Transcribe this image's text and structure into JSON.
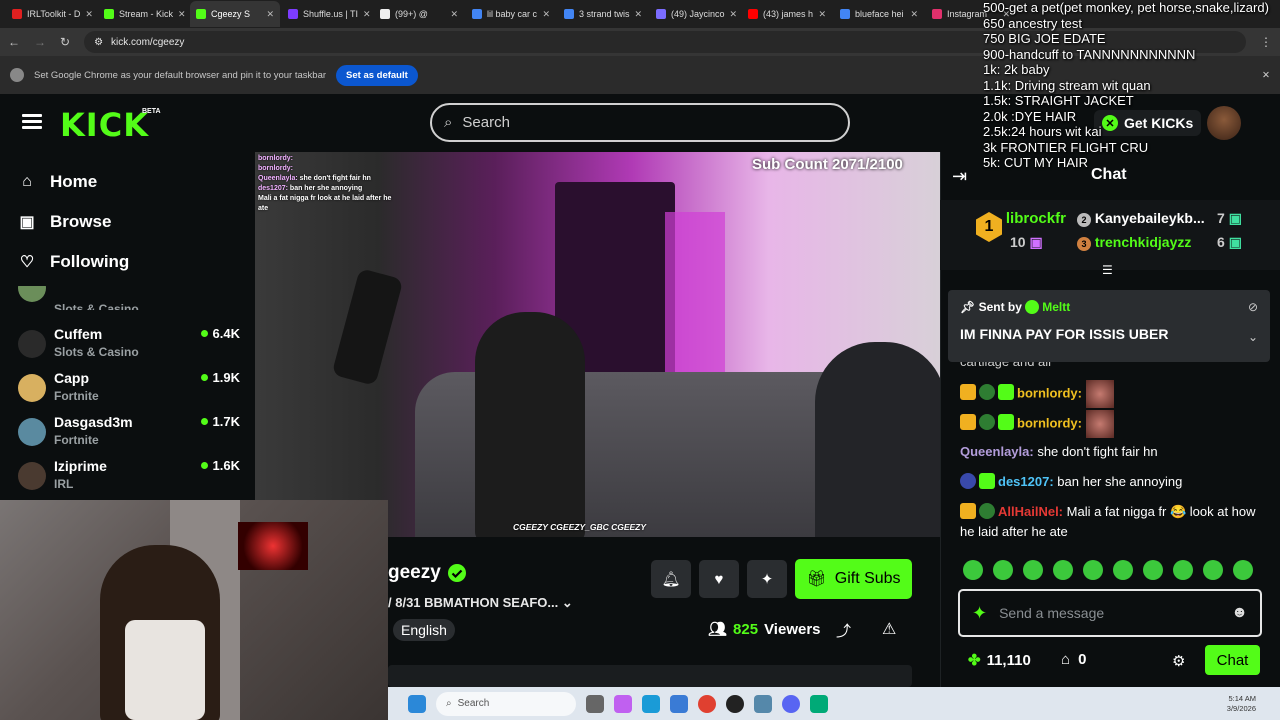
{
  "browser": {
    "tabs": [
      {
        "label": "IRLToolkit - D",
        "color": "#e02020"
      },
      {
        "label": "Stream - Kick",
        "color": "#53fc18"
      },
      {
        "label": "Cgeezy S",
        "color": "#53fc18",
        "active": true
      },
      {
        "label": "Shuffle.us | TI",
        "color": "#7d3cff"
      },
      {
        "label": "(99+) @",
        "color": "#eeeeee"
      },
      {
        "label": "lil baby car c",
        "color": "#4285f4"
      },
      {
        "label": "3 strand twis",
        "color": "#4285f4"
      },
      {
        "label": "(49) Jaycinco",
        "color": "#7b6cff"
      },
      {
        "label": "(43) james h",
        "color": "#ff0000"
      },
      {
        "label": "blueface hei",
        "color": "#4285f4"
      },
      {
        "label": "Instagram",
        "color": "#e1306c"
      }
    ],
    "url": "kick.com/cgeezy",
    "infobar_text": "Set Google Chrome as your default browser and pin it to your taskbar",
    "infobar_button": "Set as default"
  },
  "goals": [
    "500-get a pet(pet monkey, pet horse,snake,lizard)",
    "650 ancestry test",
    "750 BIG JOE EDATE",
    "900-handcuff to TANNNNNNNNNNN",
    "1k: 2k baby",
    "1.1k: Driving stream wit quan",
    "1.5k: STRAIGHT JACKET",
    "2.0k :DYE HAIR",
    "2.5k:24 hours wit kai",
    "3k FRONTIER FLIGHT CRU",
    "5k: CUT MY HAIR"
  ],
  "header": {
    "logo": "KICK",
    "beta": "BETA",
    "search_placeholder": "Search",
    "get_kicks": "Get KICKs"
  },
  "nav": [
    {
      "label": "Home",
      "icon": "home-icon",
      "glyph": "⌂"
    },
    {
      "label": "Browse",
      "icon": "browse-icon",
      "glyph": "▣"
    },
    {
      "label": "Following",
      "icon": "heart-icon",
      "glyph": "♡"
    }
  ],
  "channels": [
    {
      "name": "",
      "category": "Slots & Casino",
      "viewers": "",
      "avatar": "#6b8e5a"
    },
    {
      "name": "Cuffem",
      "category": "Slots & Casino",
      "viewers": "6.4K",
      "avatar": "#2a2a2a"
    },
    {
      "name": "Capp",
      "category": "Fortnite",
      "viewers": "1.9K",
      "avatar": "#d8b060"
    },
    {
      "name": "Dasgasd3m",
      "category": "Fortnite",
      "viewers": "1.7K",
      "avatar": "#5a8aa0"
    },
    {
      "name": "Iziprime",
      "category": "IRL",
      "viewers": "1.6K",
      "avatar": "#4a3a30"
    }
  ],
  "video": {
    "sub_count": "Sub Count 2071/2100",
    "overlay_chat": [
      {
        "user": "bornlordy:",
        "text": ""
      },
      {
        "user": "bornlordy:",
        "text": ""
      },
      {
        "user": "Queenlayla:",
        "text": "she don't fight fair hn"
      },
      {
        "user": "des1207:",
        "text": "ban her she annoying"
      },
      {
        "user": "",
        "text": "Mali a fat nigga fr look at he laid after he ate"
      }
    ],
    "credits": "CGEEZY  CGEEZY_GBC  CGEEZY"
  },
  "stream": {
    "name": "geezy",
    "title": "/ 8/31 BBMATHON SEAFO...",
    "language": "English",
    "viewers": "825",
    "viewers_label": "Viewers",
    "gift_subs": "Gift Subs"
  },
  "chat": {
    "title": "Chat",
    "leaderboard": [
      {
        "rank": "1",
        "name": "librockfr",
        "value": "10"
      },
      {
        "rank": "2",
        "name": "Kanyebaileykb...",
        "value": "7"
      },
      {
        "rank": "3",
        "name": "trenchkidjayzz",
        "value": "6"
      }
    ],
    "pinned": {
      "sent_by_label": "Sent by",
      "sender": "Meltt",
      "message": "IM FINNA PAY FOR ISSIS UBER"
    },
    "partial": "cartilage and all",
    "messages": [
      {
        "user": "bornlordy:",
        "text": "",
        "color": "#f0c020",
        "emote": true
      },
      {
        "user": "bornlordy:",
        "text": "",
        "color": "#f0c020",
        "emote": true
      },
      {
        "user": "Queenlayla:",
        "text": "she don't fight fair hn",
        "color": "#b39ddb"
      },
      {
        "user": "des1207:",
        "text": "ban her she annoying",
        "color": "#4fc3f7"
      },
      {
        "user": "AllHailNel:",
        "text": "Mali a fat nigga fr 😂 look at how he laid after he ate",
        "color": "#e53935"
      }
    ],
    "input_placeholder": "Send a message",
    "kicks": "11,110",
    "store": "0",
    "send_button": "Chat"
  },
  "taskbar": {
    "search": "Search",
    "time": "5:14 AM",
    "date": "3/9/2026"
  }
}
